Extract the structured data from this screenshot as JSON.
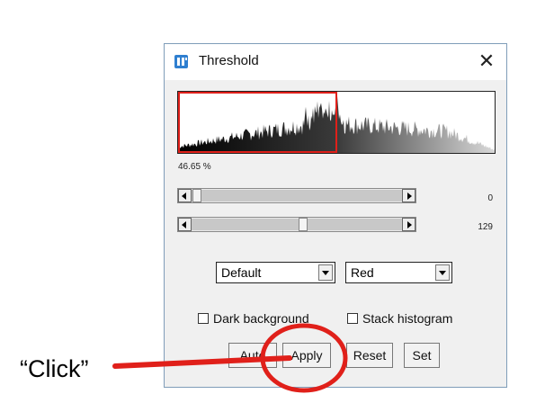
{
  "window": {
    "title": "Threshold",
    "icon": "imagej-icon",
    "close_glyph": "✕"
  },
  "histogram": {
    "percentage_label": "46.65 %",
    "threshold_color": "#e0201a"
  },
  "sliders": [
    {
      "name": "lower-threshold-slider",
      "value": "0"
    },
    {
      "name": "upper-threshold-slider",
      "value": "129"
    }
  ],
  "method_select": {
    "selected": "Default"
  },
  "display_select": {
    "selected": "Red"
  },
  "checkboxes": {
    "dark_background": {
      "label": "Dark background",
      "checked": false
    },
    "stack_histogram": {
      "label": "Stack histogram",
      "checked": false
    }
  },
  "buttons": {
    "auto": "Auto",
    "apply": "Apply",
    "reset": "Reset",
    "set": "Set"
  },
  "annotation": {
    "label": "“Click”",
    "color": "#e0201a"
  }
}
